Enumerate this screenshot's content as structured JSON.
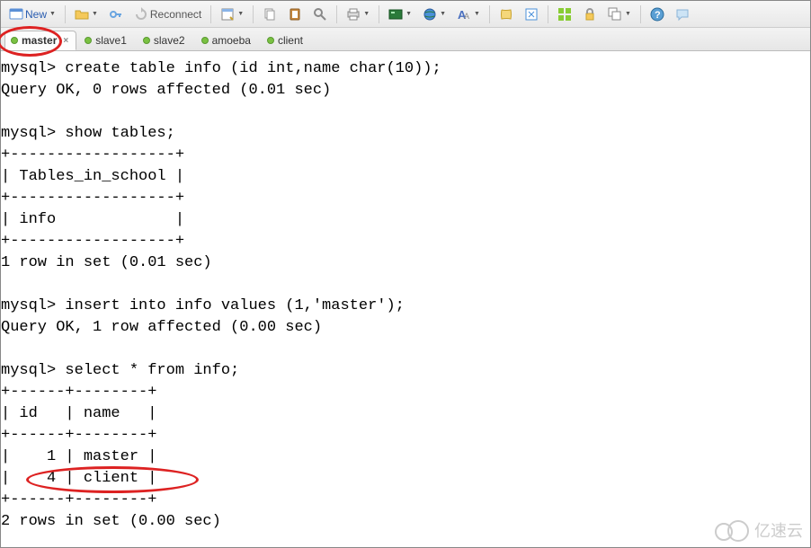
{
  "toolbar": {
    "new_label": "New",
    "reconnect_label": "Reconnect"
  },
  "tabs": [
    {
      "label": "master",
      "active": true
    },
    {
      "label": "slave1",
      "active": false
    },
    {
      "label": "slave2",
      "active": false
    },
    {
      "label": "amoeba",
      "active": false
    },
    {
      "label": "client",
      "active": false
    }
  ],
  "terminal_text": "mysql> create table info (id int,name char(10));\nQuery OK, 0 rows affected (0.01 sec)\n\nmysql> show tables;\n+------------------+\n| Tables_in_school |\n+------------------+\n| info             |\n+------------------+\n1 row in set (0.01 sec)\n\nmysql> insert into info values (1,'master');\nQuery OK, 1 row affected (0.00 sec)\n\nmysql> select * from info;\n+------+--------+\n| id   | name   |\n+------+--------+\n|    1 | master |\n|    4 | client |\n+------+--------+\n2 rows in set (0.00 sec)",
  "watermark": "亿速云"
}
